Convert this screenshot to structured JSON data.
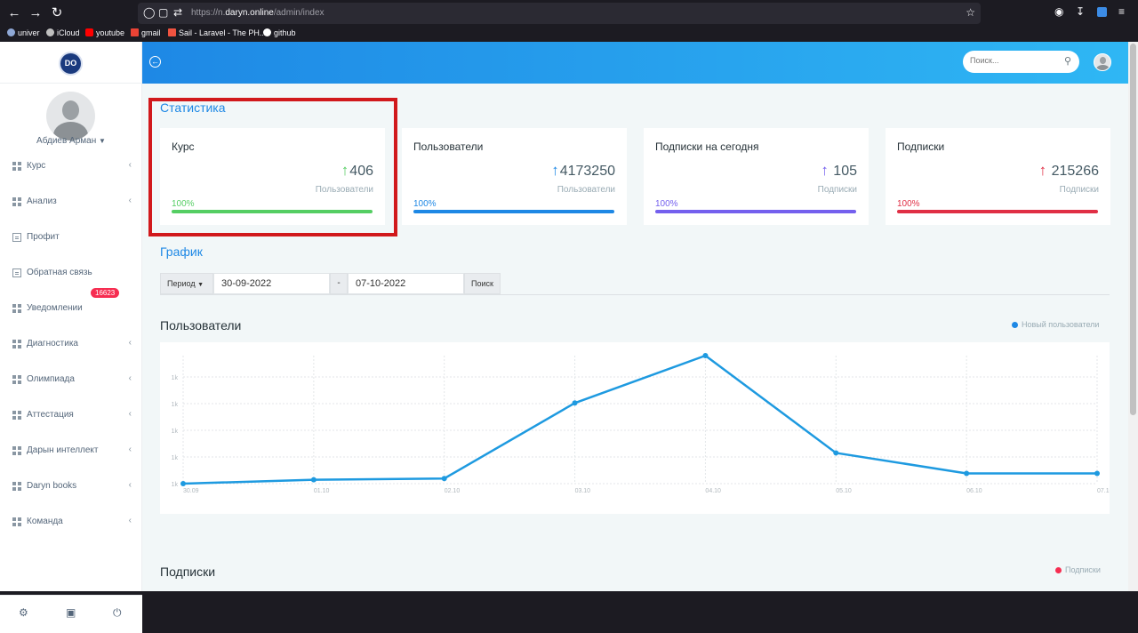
{
  "browser": {
    "url_prefix": "https://n.",
    "url_domain": "daryn.online",
    "url_path": "/admin/index",
    "bookmarks": [
      {
        "label": "univer",
        "color": "#8fa8d6"
      },
      {
        "label": "iCloud",
        "color": "#bfbfbf"
      },
      {
        "label": "youtube",
        "color": "#ff0000"
      },
      {
        "label": "gmail",
        "color": "#ea4335"
      },
      {
        "label": "Sail - Laravel - The PH...",
        "color": "#f05340"
      },
      {
        "label": "github",
        "color": "#ffffff"
      }
    ]
  },
  "sidebar": {
    "logo_text": "DO",
    "user_name": "Абдиев Арман",
    "items": [
      {
        "label": "Курс",
        "icon": "grid-icon",
        "has_chevron": true
      },
      {
        "label": "Анализ",
        "icon": "grid-icon",
        "has_chevron": true
      },
      {
        "label": "Профит",
        "icon": "document-icon",
        "has_chevron": false
      },
      {
        "label": "Обратная связь",
        "icon": "document-icon",
        "has_chevron": false
      },
      {
        "label": "Уведомлении",
        "icon": "grid-icon",
        "has_chevron": false
      },
      {
        "label": "Диагностика",
        "icon": "grid-icon",
        "has_chevron": true
      },
      {
        "label": "Олимпиада",
        "icon": "grid-icon",
        "has_chevron": true
      },
      {
        "label": "Аттестация",
        "icon": "grid-icon",
        "has_chevron": true
      },
      {
        "label": "Дарын интеллект",
        "icon": "grid-icon",
        "has_chevron": true
      },
      {
        "label": "Daryn books",
        "icon": "grid-icon",
        "has_chevron": true
      },
      {
        "label": "Команда",
        "icon": "grid-icon",
        "has_chevron": true
      }
    ],
    "notification_badge": "16623"
  },
  "topbar": {
    "search_placeholder": "Поиск..."
  },
  "statistics": {
    "title": "Статистика",
    "cards": [
      {
        "title": "Курс",
        "value": "406",
        "subtitle": "Пользователи",
        "percent": "100%",
        "color": "#55ce63"
      },
      {
        "title": "Пользователи",
        "value": "4173250",
        "subtitle": "Пользователи",
        "percent": "100%",
        "color": "#1e88e5"
      },
      {
        "title": "Подписки на сегодня",
        "value": "105",
        "subtitle": "Подписки",
        "percent": "100%",
        "color": "#7460ee"
      },
      {
        "title": "Подписки",
        "value": "215266",
        "subtitle": "Подписки",
        "percent": "100%",
        "color": "#e02f45"
      }
    ]
  },
  "graph": {
    "title": "График",
    "period_label": "Период",
    "date_from": "30-09-2022",
    "date_separator": "-",
    "date_to": "07-10-2022",
    "search_label": "Поиск"
  },
  "users_panel": {
    "title": "Пользователи",
    "legend": "Новый пользователи",
    "legend_color": "#1e88e5"
  },
  "subs_panel": {
    "title": "Подписки",
    "legend": "Подписки",
    "legend_color": "#f62d51"
  },
  "chart_data": {
    "type": "line",
    "title": "Пользователи",
    "categories": [
      "30.09",
      "01.10",
      "02.10",
      "03.10",
      "04.10",
      "05.10",
      "06.10",
      "07.10"
    ],
    "y_tick_labels": [
      "1k",
      "1k",
      "1k",
      "1k",
      "1k"
    ],
    "series": [
      {
        "name": "Новый пользователи",
        "values": [
          0.0,
          0.03,
          0.04,
          0.63,
          1.0,
          0.24,
          0.08,
          0.08
        ]
      }
    ],
    "ylim": [
      0,
      1
    ],
    "grid": true,
    "legend_position": "top-right"
  }
}
